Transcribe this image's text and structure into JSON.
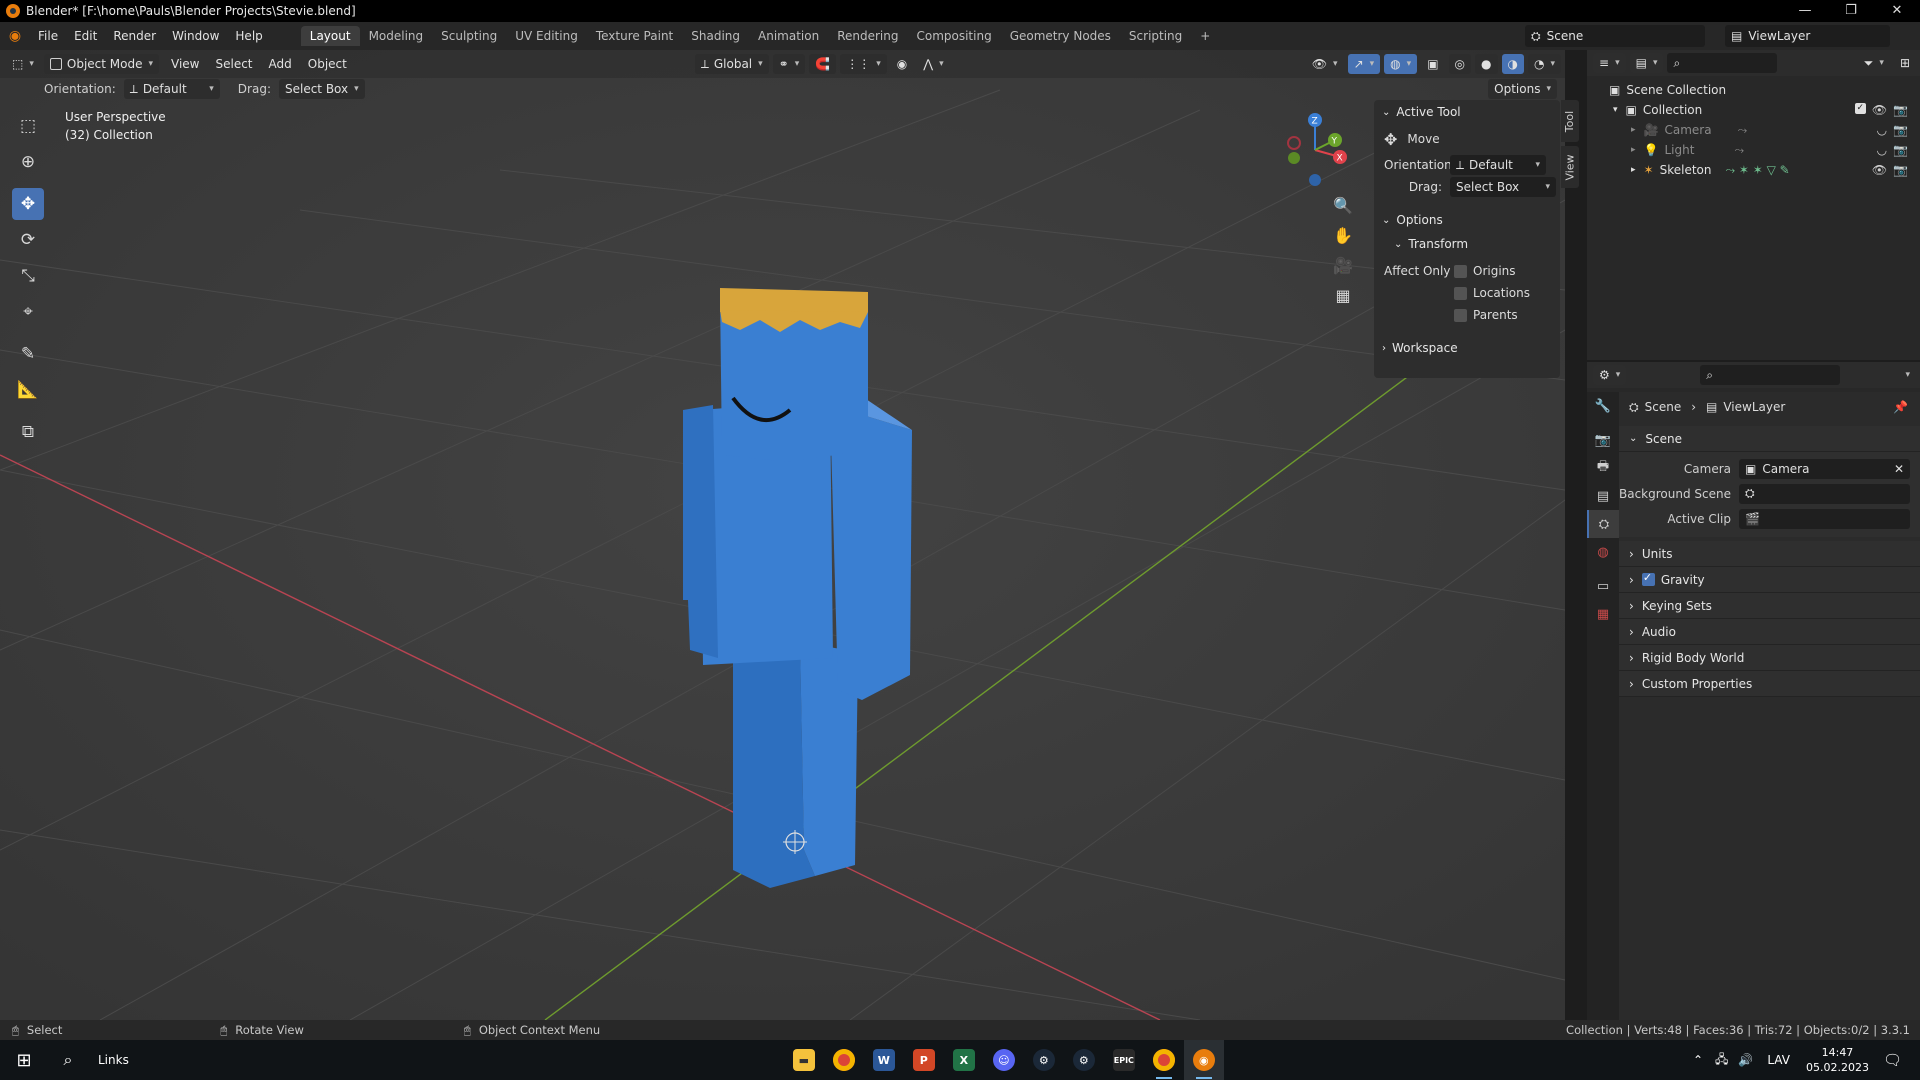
{
  "window": {
    "title": "Blender* [F:\\home\\Pauls\\Blender Projects\\Stevie.blend]",
    "controls": [
      "—",
      "❐",
      "✕"
    ]
  },
  "menu": [
    "File",
    "Edit",
    "Render",
    "Window",
    "Help"
  ],
  "workspaces": [
    "Layout",
    "Modeling",
    "Sculpting",
    "UV Editing",
    "Texture Paint",
    "Shading",
    "Animation",
    "Rendering",
    "Compositing",
    "Geometry Nodes",
    "Scripting"
  ],
  "add_workspace": "+",
  "scene_name": "Scene",
  "view_layer": "ViewLayer",
  "viewport_header": {
    "mode": "Object Mode",
    "menus": [
      "View",
      "Select",
      "Add",
      "Object"
    ],
    "transform": "Global",
    "orientation_label": "Orientation:",
    "orientation_value": "Default",
    "drag_label": "Drag:",
    "drag_value": "Select Box",
    "options": "Options"
  },
  "viewport_info": {
    "line1": "User Perspective",
    "line2": "(32) Collection"
  },
  "gizmo": {
    "x": "X",
    "y": "Y",
    "z": "Z",
    "colors": {
      "x": "#e0424b",
      "y": "#6ba52b",
      "z": "#3a7fd6"
    }
  },
  "npanel": {
    "active_tool_header": "Active Tool",
    "tool_name": "Move",
    "orientation_label": "Orientation",
    "orientation_value": "Default",
    "drag_label": "Drag:",
    "drag_value": "Select Box",
    "options_header": "Options",
    "transform_header": "Transform",
    "affect_only": "Affect Only",
    "origins": "Origins",
    "locations": "Locations",
    "parents": "Parents",
    "workspace_header": "Workspace",
    "tabs": [
      "Tool",
      "View"
    ]
  },
  "outliner": {
    "scene_collection": "Scene Collection",
    "collection": "Collection",
    "items": [
      {
        "name": "Camera",
        "icon": "camera-icon",
        "dim": true
      },
      {
        "name": "Light",
        "icon": "light-icon",
        "dim": true
      },
      {
        "name": "Skeleton",
        "icon": "armature-icon",
        "dim": false
      }
    ]
  },
  "properties": {
    "breadcrumb_scene": "Scene",
    "breadcrumb_viewlayer": "ViewLayer",
    "scene_section": "Scene",
    "camera_label": "Camera",
    "camera_value": "Camera",
    "background_label": "Background Scene",
    "active_clip_label": "Active Clip",
    "sections": [
      "Units",
      "Gravity",
      "Keying Sets",
      "Audio",
      "Rigid Body World",
      "Custom Properties"
    ],
    "gravity_checked": true
  },
  "statusbar": {
    "select": "Select",
    "rotate": "Rotate View",
    "context": "Object Context Menu",
    "stats": "Collection | Verts:48 | Faces:36 | Tris:72 | Objects:0/2 | 3.3.1"
  },
  "taskbar": {
    "search": "Links",
    "apps": [
      {
        "name": "file-explorer-icon",
        "label": "",
        "color": "#f4c23c"
      },
      {
        "name": "chrome-icon",
        "label": "",
        "color": "#db4437"
      },
      {
        "name": "word-icon",
        "label": "W",
        "color": "#2b5797"
      },
      {
        "name": "powerpoint-icon",
        "label": "P",
        "color": "#d24726"
      },
      {
        "name": "excel-icon",
        "label": "X",
        "color": "#217346"
      },
      {
        "name": "discord-icon",
        "label": "",
        "color": "#5865f2"
      },
      {
        "name": "steam-icon",
        "label": "",
        "color": "#1b2838"
      },
      {
        "name": "steam-icon-2",
        "label": "",
        "color": "#1b2838"
      },
      {
        "name": "epic-games-icon",
        "label": "EPIC",
        "color": "#2a2a2a"
      },
      {
        "name": "chrome-icon-2",
        "label": "",
        "color": "#db4437"
      },
      {
        "name": "blender-icon",
        "label": "",
        "color": "#e87d0d"
      }
    ],
    "lang": "LAV",
    "time": "14:47",
    "date": "05.02.2023"
  }
}
